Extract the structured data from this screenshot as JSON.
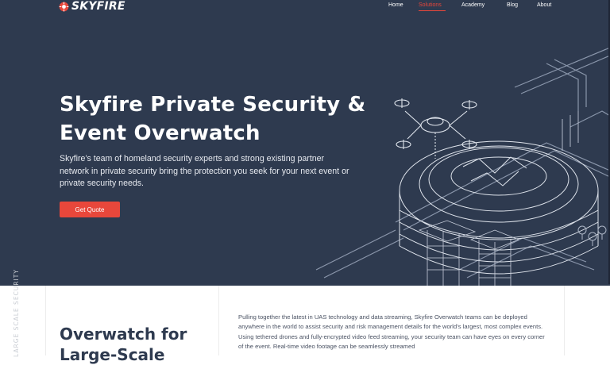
{
  "brand": {
    "name": "SKYFIRE",
    "accent": "#e8473b",
    "hero_bg": "#2e3a4f"
  },
  "nav": {
    "items": [
      {
        "label": "Home",
        "active": false
      },
      {
        "label": "Solutions",
        "active": true
      },
      {
        "label": "Academy",
        "active": false
      },
      {
        "label": "Blog",
        "active": false
      },
      {
        "label": "About",
        "active": false
      }
    ]
  },
  "hero": {
    "title": "Skyfire Private Security & Event Overwatch",
    "description": "Skyfire’s team of homeland security experts and strong existing partner network in private security bring the protection you seek for your next event or private security needs.",
    "cta_label": "Get Quote",
    "illustration_icon": "drone-over-stadium-illustration"
  },
  "section": {
    "vertical_label": "LARGE SCALE SECURITY",
    "title": "Overwatch for Large-Scale",
    "body": "Pulling together the latest in UAS technology and data streaming, Skyfire Overwatch teams can be deployed anywhere in the world to assist security and risk management details for the world’s largest, most complex events. Using tethered drones and fully-encrypted video feed streaming, your security team can have eyes on every corner of the event. Real-time video footage can be seamlessly streamed"
  }
}
